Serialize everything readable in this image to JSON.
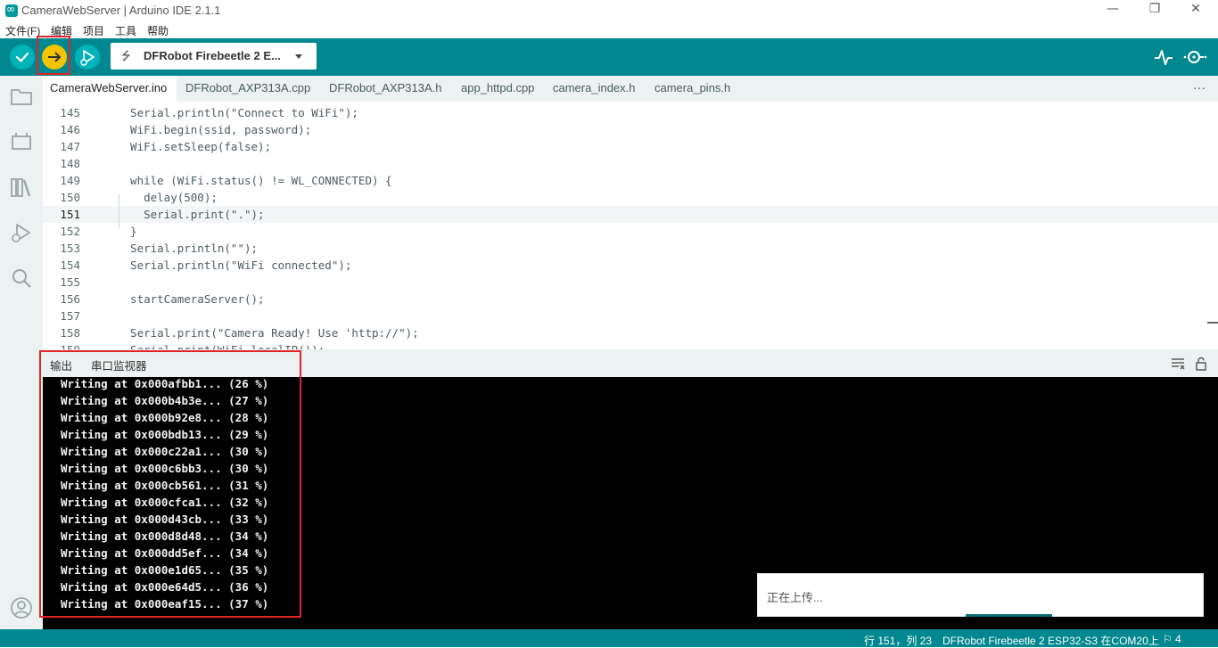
{
  "window": {
    "title": "CameraWebServer | Arduino IDE 2.1.1",
    "minimize_glyph": "—",
    "restore_glyph": "❐",
    "close_glyph": "✕"
  },
  "menu": [
    "文件(F)",
    "编辑",
    "项目",
    "工具",
    "帮助"
  ],
  "toolbar": {
    "verify_icon": "checkmark-icon",
    "upload_icon": "arrow-right-icon",
    "debug_icon": "debug-icon",
    "board": "DFRobot Firebeetle 2 E...",
    "accent": "#00878f",
    "upload_color": "#f5c400",
    "highlight_color": "#e0242a"
  },
  "tabs": [
    {
      "label": "CameraWebServer.ino",
      "active": true
    },
    {
      "label": "DFRobot_AXP313A.cpp"
    },
    {
      "label": "DFRobot_AXP313A.h"
    },
    {
      "label": "app_httpd.cpp"
    },
    {
      "label": "camera_index.h"
    },
    {
      "label": "camera_pins.h"
    }
  ],
  "tabs_more": "···",
  "editor": {
    "lines": [
      {
        "n": "145",
        "code": "  Serial.println(\"Connect to WiFi\");"
      },
      {
        "n": "146",
        "code": "  WiFi.begin(ssid, password);"
      },
      {
        "n": "147",
        "code": "  WiFi.setSleep(false);"
      },
      {
        "n": "148",
        "code": ""
      },
      {
        "n": "149",
        "code": "  while (WiFi.status() != WL_CONNECTED) {"
      },
      {
        "n": "150",
        "code": "    delay(500);"
      },
      {
        "n": "151",
        "code": "    Serial.print(\".\");"
      },
      {
        "n": "152",
        "code": "  }"
      },
      {
        "n": "153",
        "code": "  Serial.println(\"\");"
      },
      {
        "n": "154",
        "code": "  Serial.println(\"WiFi connected\");"
      },
      {
        "n": "155",
        "code": ""
      },
      {
        "n": "156",
        "code": "  startCameraServer();"
      },
      {
        "n": "157",
        "code": ""
      },
      {
        "n": "158",
        "code": "  Serial.print(\"Camera Ready! Use 'http://\");"
      },
      {
        "n": "159",
        "code": "  Serial.print(WiFi.localIP());"
      }
    ],
    "current_line": "151"
  },
  "panel": {
    "tabs": [
      "输出",
      "串口监视器"
    ],
    "output_lines": [
      "Writing at 0x000afbb1... (26 %)",
      "Writing at 0x000b4b3e... (27 %)",
      "Writing at 0x000b92e8... (28 %)",
      "Writing at 0x000bdb13... (29 %)",
      "Writing at 0x000c22a1... (30 %)",
      "Writing at 0x000c6bb3... (30 %)",
      "Writing at 0x000cb561... (31 %)",
      "Writing at 0x000cfca1... (32 %)",
      "Writing at 0x000d43cb... (33 %)",
      "Writing at 0x000d8d48... (34 %)",
      "Writing at 0x000dd5ef... (34 %)",
      "Writing at 0x000e1d65... (35 %)",
      "Writing at 0x000e64d5... (36 %)",
      "Writing at 0x000eaf15... (37 %)"
    ]
  },
  "toast": {
    "text": "正在上传..."
  },
  "status": {
    "cursor": "行 151，列 23",
    "board_port": "DFRobot Firebeetle 2 ESP32-S3 在COM20上",
    "notifications": "4"
  }
}
